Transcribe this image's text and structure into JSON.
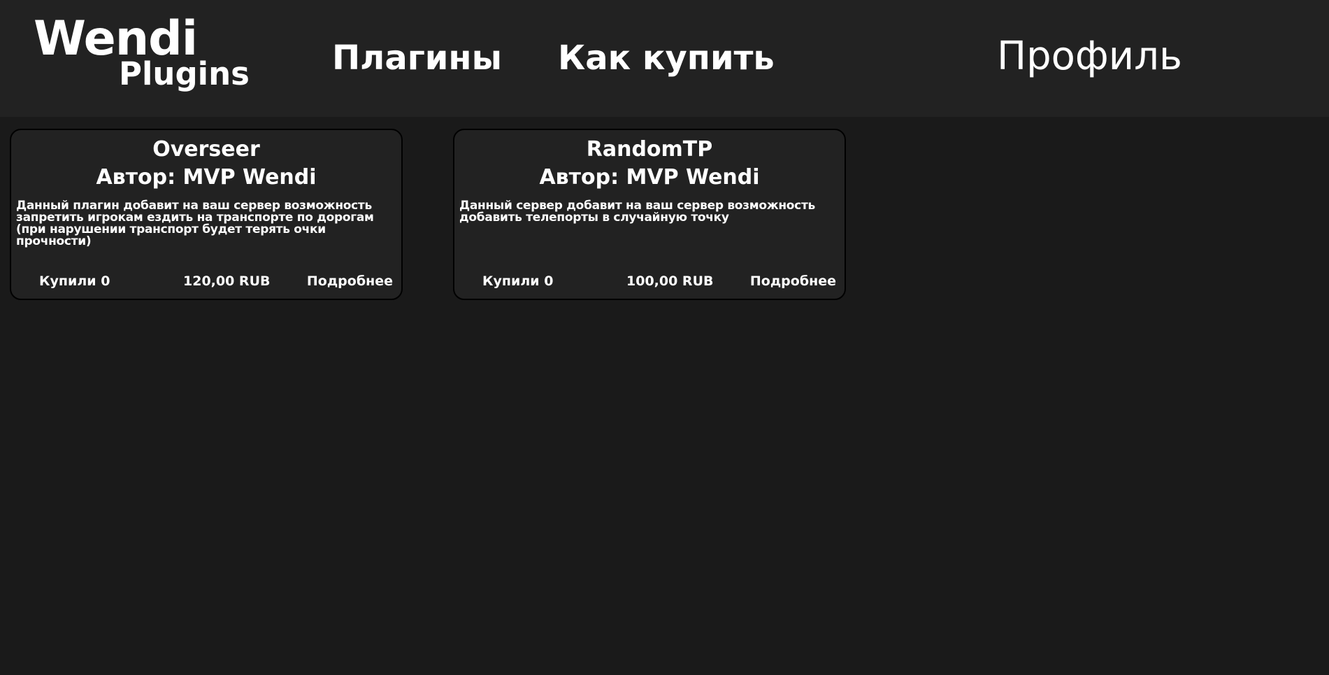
{
  "header": {
    "logo_top": "Wendi",
    "logo_bottom": "Plugins",
    "nav": {
      "plugins": "Плагины",
      "how_to_buy": "Как купить",
      "profile": "Профиль"
    }
  },
  "plugins": [
    {
      "title": "Overseer",
      "author": "Автор: MVP Wendi",
      "description": "Данный плагин добавит на ваш сервер возможность запретить игрокам ездить на транспорте по дорогам (при нарушении транспорт будет терять очки прочности)",
      "bought": "Купили 0",
      "price": "120,00 RUB",
      "more_label": "Подробнее"
    },
    {
      "title": "RandomTP",
      "author": "Автор: MVP Wendi",
      "description": "Данный сервер добавит на ваш сервер возможность добавить телепорты в случайную точку",
      "bought": "Купили 0",
      "price": "100,00 RUB",
      "more_label": "Подробнее"
    }
  ],
  "colors": {
    "background": "#1a1a1a",
    "header_background": "#222222",
    "card_background": "#222222",
    "card_border": "#000000",
    "text": "#ffffff"
  }
}
